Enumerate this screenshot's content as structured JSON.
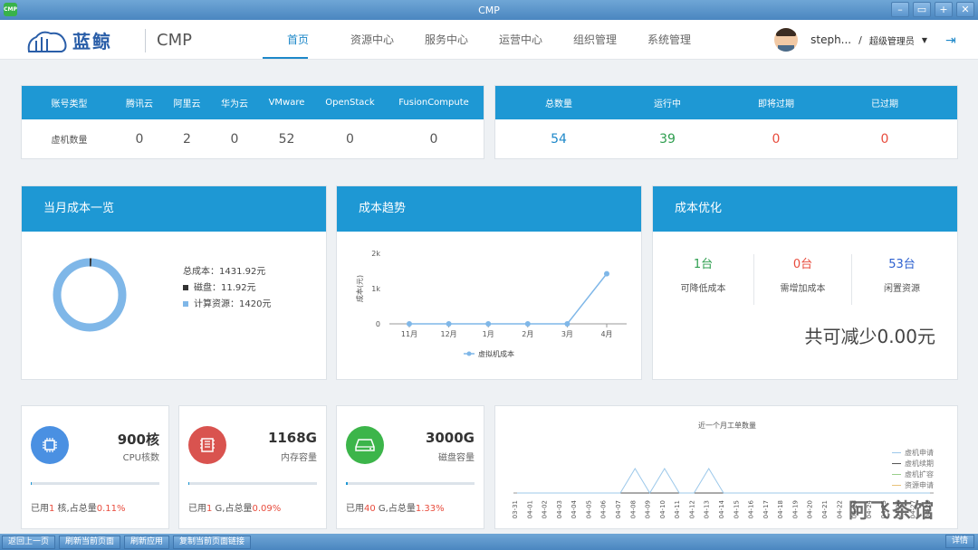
{
  "window": {
    "title": "CMP",
    "app_icon": "CMP"
  },
  "header": {
    "brand": "蓝鲸",
    "product": "CMP",
    "nav": [
      {
        "label": "首页",
        "active": true
      },
      {
        "label": "资源中心"
      },
      {
        "label": "服务中心"
      },
      {
        "label": "运营中心"
      },
      {
        "label": "组织管理"
      },
      {
        "label": "系统管理"
      }
    ],
    "user": {
      "name": "steph...",
      "role": "超级管理员"
    }
  },
  "accounts": {
    "headers": [
      "账号类型",
      "腾讯云",
      "阿里云",
      "华为云",
      "VMware",
      "OpenStack",
      "FusionCompute"
    ],
    "row_label": "虚机数量",
    "values": [
      "0",
      "2",
      "0",
      "52",
      "0",
      "0"
    ]
  },
  "vm_status": {
    "headers": [
      "总数量",
      "运行中",
      "即将过期",
      "已过期"
    ],
    "values": [
      "54",
      "39",
      "0",
      "0"
    ],
    "colors": [
      "#1e88c9",
      "#2e9e4f",
      "#e84c3d",
      "#e84c3d"
    ]
  },
  "monthly_cost": {
    "title": "当月成本一览",
    "total": "总成本：1431.92元",
    "disk": "磁盘：11.92元",
    "compute": "计算资源：1420元",
    "donut_fractions": {
      "disk": 0.0083,
      "compute": 0.9917
    }
  },
  "cost_trend": {
    "title": "成本趋势",
    "chart_data": {
      "type": "line",
      "categories": [
        "11月",
        "12月",
        "1月",
        "2月",
        "3月",
        "4月"
      ],
      "series": [
        {
          "name": "虚拟机成本",
          "values": [
            0,
            0,
            0,
            0,
            0,
            1420
          ]
        }
      ],
      "ylabel": "成本(元)",
      "yticks": [
        "0",
        "1k",
        "2k"
      ],
      "ylim": [
        0,
        2000
      ]
    }
  },
  "cost_opt": {
    "title": "成本优化",
    "items": [
      {
        "value": "1台",
        "label": "可降低成本",
        "color": "#2e9e4f"
      },
      {
        "value": "0台",
        "label": "需增加成本",
        "color": "#e84c3d"
      },
      {
        "value": "53台",
        "label": "闲置资源",
        "color": "#2b5fcf"
      }
    ],
    "summary": "共可减少0.00元"
  },
  "resources": [
    {
      "value": "900核",
      "label": "CPU核数",
      "used_prefix": "已用",
      "used_num": "1",
      "used_mid": " 核,占总量",
      "used_pct": "0.11%",
      "color": "#4a90e2",
      "fraction": 0.0011
    },
    {
      "value": "1168G",
      "label": "内存容量",
      "used_prefix": "已用",
      "used_num": "1",
      "used_mid": " G,占总量",
      "used_pct": "0.09%",
      "color": "#d9534f",
      "fraction": 0.0009
    },
    {
      "value": "3000G",
      "label": "磁盘容量",
      "used_prefix": "已用",
      "used_num": "40",
      "used_mid": " G,占总量",
      "used_pct": "1.33%",
      "color": "#3cb54a",
      "fraction": 0.0133
    }
  ],
  "ticket_chart": {
    "title": "近一个月工单数量",
    "chart_data": {
      "type": "line",
      "categories": [
        "03-31",
        "04-01",
        "04-02",
        "04-03",
        "04-04",
        "04-05",
        "04-06",
        "04-07",
        "04-08",
        "04-09",
        "04-10",
        "04-11",
        "04-12",
        "04-13",
        "04-14",
        "04-15",
        "04-16",
        "04-17",
        "04-18",
        "04-19",
        "04-20",
        "04-21",
        "04-22",
        "04-23",
        "04-24",
        "04-25",
        "04-26",
        "04-27",
        "04-28"
      ],
      "series": [
        {
          "name": "虚机申请",
          "values": [
            0,
            0,
            0,
            0,
            0,
            0,
            0,
            0,
            1,
            0,
            1,
            0,
            0,
            1,
            0,
            0,
            0,
            0,
            0,
            0,
            0,
            0,
            0,
            0,
            0,
            0,
            0,
            0,
            0
          ],
          "color": "#9cc8ea"
        },
        {
          "name": "虚机续期",
          "values": [
            0,
            0,
            0,
            0,
            0,
            0,
            0,
            0,
            0,
            0,
            0,
            0,
            0,
            0,
            0,
            0,
            0,
            0,
            0,
            0,
            0,
            0,
            0,
            0,
            0,
            0,
            0,
            0,
            0
          ],
          "color": "#555555"
        },
        {
          "name": "虚机扩容",
          "values": [
            0,
            0,
            0,
            0,
            0,
            0,
            0,
            0,
            0,
            0,
            0,
            0,
            0,
            0,
            0,
            0,
            0,
            0,
            0,
            0,
            0,
            0,
            0,
            0,
            0,
            0,
            0,
            0,
            0
          ],
          "color": "#9bd08c"
        },
        {
          "name": "资源申请",
          "values": [
            0,
            0,
            0,
            0,
            0,
            0,
            0,
            0,
            0,
            0,
            0,
            0,
            0,
            0,
            0,
            0,
            0,
            0,
            0,
            0,
            0,
            0,
            0,
            0,
            0,
            0,
            0,
            0,
            0
          ],
          "color": "#e8c27a"
        }
      ]
    }
  },
  "watermark": "阿飞茶馆",
  "bottombar": {
    "buttons": [
      "返回上一页",
      "刷新当前页面",
      "刷新应用",
      "复制当前页面链接"
    ],
    "detail": "详情"
  }
}
